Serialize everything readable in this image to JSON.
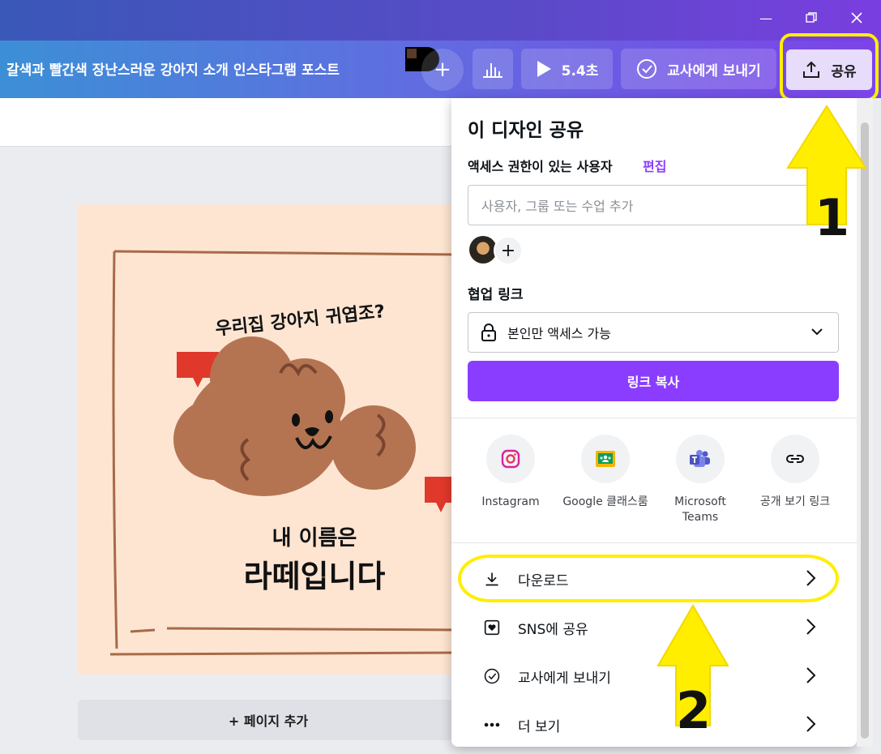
{
  "header": {
    "title": "갈색과 빨간색 장난스러운 강아지 소개 인스타그램 포스트",
    "play_label": "5.4초",
    "send_teacher_label": "교사에게 보내기",
    "share_label": "공유"
  },
  "canvas": {
    "text_top": "우리집 강아지 귀엽조?",
    "text_name_line1": "내 이름은",
    "text_name_line2": "라떼입니다",
    "add_page_label": "+ 페이지 추가"
  },
  "share_panel": {
    "title": "이 디자인 공유",
    "access_label": "액세스 권한이 있는 사용자",
    "edit_label": "편집",
    "add_placeholder": "사용자, 그룹 또는 수업 추가",
    "collab_label": "협업 링크",
    "access_select": "본인만 액세스 가능",
    "copy_link_label": "링크 복사",
    "options": [
      {
        "label": "Instagram",
        "icon": "instagram-icon"
      },
      {
        "label": "Google 클래스룸",
        "icon": "google-classroom-icon"
      },
      {
        "label": "Microsoft Teams",
        "icon": "teams-icon"
      },
      {
        "label": "공개 보기 링크",
        "icon": "link-icon"
      }
    ],
    "rows": [
      {
        "label": "다운로드",
        "icon": "download-icon"
      },
      {
        "label": "SNS에 공유",
        "icon": "heart-icon"
      },
      {
        "label": "교사에게 보내기",
        "icon": "check-circle-icon"
      },
      {
        "label": "더 보기",
        "icon": "more-icon"
      }
    ]
  },
  "annotations": {
    "step1": "1",
    "step2": "2",
    "highlight_color": "#ffee00"
  }
}
